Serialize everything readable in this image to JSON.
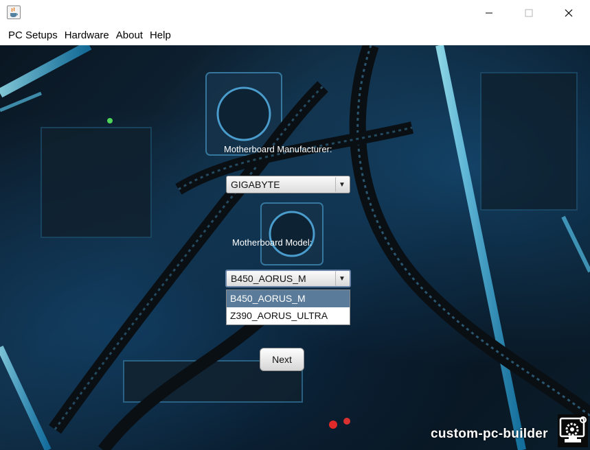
{
  "window": {
    "title": "",
    "controls": {
      "minimize_icon": "minimize-icon",
      "maximize_icon": "maximize-icon",
      "close_icon": "close-icon"
    }
  },
  "menubar": {
    "items": [
      {
        "label": "PC Setups"
      },
      {
        "label": "Hardware"
      },
      {
        "label": "About"
      },
      {
        "label": "Help"
      }
    ]
  },
  "form": {
    "manufacturer_label": "Motherboard Manufacturer:",
    "manufacturer_value": "GIGABYTE",
    "model_label": "Motherboard Model:",
    "model_value": "B450_AORUS_M",
    "model_options": [
      "B450_AORUS_M",
      "Z390_AORUS_ULTRA"
    ],
    "model_selected_index": 0,
    "next_label": "Next"
  },
  "branding": {
    "text": "custom-pc-builder",
    "logo_icon": "pc-builder-gear-icon"
  },
  "colors": {
    "selection": "#5a7c9a",
    "background_accent": "#1fb8ff",
    "titlebar": "#ffffff"
  }
}
